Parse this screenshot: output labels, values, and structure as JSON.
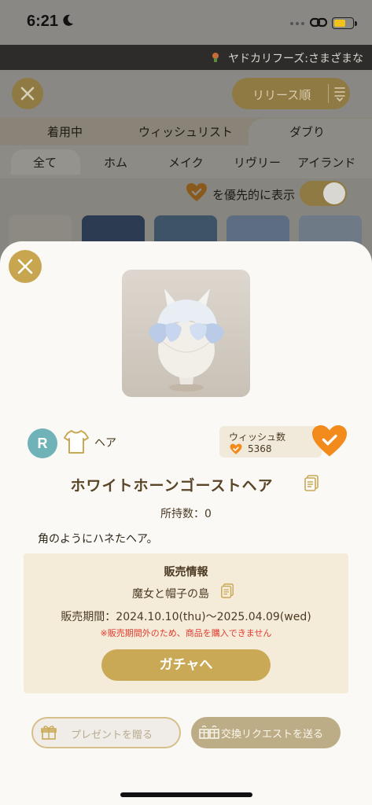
{
  "status_bar": {
    "time": "6:21"
  },
  "ticker": {
    "text": "ヤドカリフーズ:さまざまな"
  },
  "toolbar": {
    "sort_label": "リリース順"
  },
  "tabs": [
    {
      "label": "着用中",
      "active": false
    },
    {
      "label": "ウィッシュリスト",
      "active": false
    },
    {
      "label": "ダブり",
      "active": true
    }
  ],
  "categories": [
    {
      "label": "全て",
      "active": true
    },
    {
      "label": "ホム",
      "active": false
    },
    {
      "label": "メイク",
      "active": false
    },
    {
      "label": "リヴリー",
      "active": false
    },
    {
      "label": "アイランド",
      "active": false
    }
  ],
  "priority": {
    "label": "を優先的に表示",
    "enabled": true
  },
  "item": {
    "rarity": "R",
    "category": "ヘア",
    "wish_label": "ウィッシュ数",
    "wish_count": "5368",
    "name": "ホワイトホーンゴーストヘア",
    "owned": "所持数：0",
    "description": "角のようにハネたヘア。"
  },
  "sale": {
    "title": "販売情報",
    "gacha_name": "魔女と帽子の島",
    "period": "販売期間：2024.10.10(thu)〜2025.04.09(wed)",
    "warning": "※販売期間外のため、商品を購入できません",
    "gacha_button": "ガチャへ"
  },
  "actions": {
    "gift_label": "プレゼントを贈る",
    "exchange_label": "交換リクエストを送る"
  },
  "colors": {
    "accent_gold": "#c9a955",
    "wish_orange": "#f28a1c",
    "rarity_teal": "#6fb3b8",
    "warning_red": "#e23a2f"
  }
}
